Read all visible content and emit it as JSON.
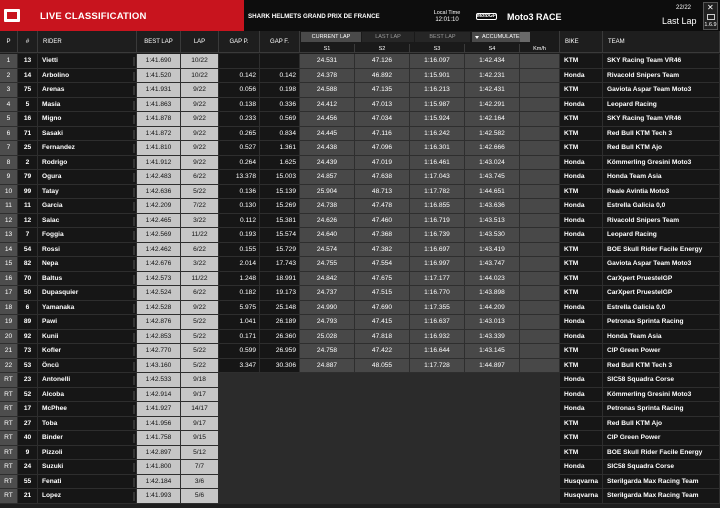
{
  "header": {
    "title": "LIVE CLASSIFICATION",
    "event": "SHARK HELMETS GRAND PRIX DE FRANCE",
    "local_time_label": "Local Time",
    "local_time": "12:01:10",
    "series_logo": "MotoGP",
    "race": "Moto3 RACE",
    "lap_counter": "22/22",
    "lap_status": "Last Lap",
    "close_glyph": "✕",
    "version": "1.6.9"
  },
  "columns": {
    "pos": "P",
    "num": "#",
    "rider": "RIDER",
    "best_lap": "BEST LAP",
    "lap": "LAP",
    "gap_p": "GAP P.",
    "gap_f": "GAP F.",
    "current_lap": "CURRENT LAP",
    "last_lap": "LAST LAP",
    "best_lap_tab": "BEST LAP",
    "accumulated": "ACCUMULATED",
    "s1": "S1",
    "s2": "S2",
    "s3": "S3",
    "s4": "S4",
    "speed": "Km/h",
    "bike": "BIKE",
    "team": "TEAM"
  },
  "rows": [
    {
      "pos": "1",
      "num": "13",
      "rider": "Vietti",
      "best": "1:41.690",
      "lap": "10/22",
      "gp": "",
      "gf": "",
      "s1": "24.531",
      "s2": "47.126",
      "s3": "1:16.097",
      "s4": "1:42.434",
      "bike": "KTM",
      "team": "SKY Racing Team VR46"
    },
    {
      "pos": "2",
      "num": "14",
      "rider": "Arbolino",
      "best": "1:41.520",
      "lap": "10/22",
      "gp": "0.142",
      "gf": "0.142",
      "s1": "24.378",
      "s2": "46.892",
      "s3": "1:15.901",
      "s4": "1:42.231",
      "bike": "Honda",
      "team": "Rivacold Snipers Team"
    },
    {
      "pos": "3",
      "num": "75",
      "rider": "Arenas",
      "best": "1:41.931",
      "bestbg": "lap",
      "lap": "9/22",
      "gp": "0.056",
      "gf": "0.198",
      "s1": "24.588",
      "s2": "47.135",
      "s3": "1:16.213",
      "s4": "1:42.431",
      "bike": "KTM",
      "team": "Gaviota Aspar Team Moto3"
    },
    {
      "pos": "4",
      "num": "5",
      "rider": "Masia",
      "best": "1:41.863",
      "lap": "9/22",
      "gp": "0.138",
      "gf": "0.336",
      "s1": "24.412",
      "s2": "47.013",
      "s3": "1:15.987",
      "s4": "1:42.291",
      "bike": "Honda",
      "team": "Leopard Racing"
    },
    {
      "pos": "5",
      "num": "16",
      "rider": "Migno",
      "best": "1:41.878",
      "lap": "9/22",
      "gp": "0.233",
      "gf": "0.569",
      "s1": "24.456",
      "s2": "47.034",
      "s3": "1:15.924",
      "s4": "1:42.164",
      "bike": "KTM",
      "team": "SKY Racing Team VR46"
    },
    {
      "pos": "6",
      "num": "71",
      "rider": "Sasaki",
      "best": "1:41.872",
      "lap": "9/22",
      "gp": "0.265",
      "gf": "0.834",
      "s1": "24.445",
      "s2": "47.116",
      "s3": "1:16.242",
      "s4": "1:42.582",
      "bike": "KTM",
      "team": "Red Bull KTM Tech 3"
    },
    {
      "pos": "7",
      "num": "25",
      "rider": "Fernandez",
      "best": "1:41.810",
      "lap": "9/22",
      "gp": "0.527",
      "gf": "1.361",
      "s1": "24.438",
      "s2": "47.096",
      "s3": "1:16.301",
      "s4": "1:42.666",
      "bike": "KTM",
      "team": "Red Bull KTM Ajo"
    },
    {
      "pos": "8",
      "num": "2",
      "rider": "Rodrigo",
      "best": "1:41.912",
      "lap": "9/22",
      "gp": "0.264",
      "gf": "1.625",
      "s1": "24.439",
      "s2": "47.019",
      "s3": "1:16.461",
      "s4": "1:43.024",
      "bike": "Honda",
      "team": "Kömmerling Gresini Moto3"
    },
    {
      "pos": "9",
      "num": "79",
      "rider": "Ogura",
      "best": "1:42.483",
      "lap": "6/22",
      "gp": "13.378",
      "gf": "15.003",
      "s1": "24.857",
      "s2": "47.638",
      "s3": "1:17.043",
      "s4": "1:43.745",
      "bike": "Honda",
      "team": "Honda Team Asia"
    },
    {
      "pos": "10",
      "num": "99",
      "rider": "Tatay",
      "best": "1:42.636",
      "lap": "5/22",
      "gp": "0.136",
      "gf": "15.139",
      "s1": "25.904",
      "s2": "48.713",
      "s3": "1:17.782",
      "s4": "1:44.651",
      "bike": "KTM",
      "team": "Reale Avintia Moto3"
    },
    {
      "pos": "11",
      "num": "11",
      "rider": "Garcia",
      "best": "1:42.209",
      "lap": "7/22",
      "gp": "0.130",
      "gf": "15.269",
      "s1": "24.738",
      "s2": "47.478",
      "s3": "1:16.855",
      "s4": "1:43.636",
      "bike": "Honda",
      "team": "Estrella Galicia 0,0"
    },
    {
      "pos": "12",
      "num": "12",
      "rider": "Salac",
      "best": "1:42.465",
      "lap": "3/22",
      "gp": "0.112",
      "gf": "15.381",
      "s1": "24.626",
      "s2": "47.460",
      "s3": "1:16.719",
      "s4": "1:43.513",
      "bike": "Honda",
      "team": "Rivacold Snipers Team"
    },
    {
      "pos": "13",
      "num": "7",
      "rider": "Foggia",
      "best": "1:42.569",
      "lap": "11/22",
      "gp": "0.193",
      "gf": "15.574",
      "s1": "24.640",
      "s2": "47.368",
      "s3": "1:16.739",
      "s4": "1:43.530",
      "bike": "Honda",
      "team": "Leopard Racing"
    },
    {
      "pos": "14",
      "num": "54",
      "rider": "Rossi",
      "best": "1:42.462",
      "lap": "6/22",
      "gp": "0.155",
      "gf": "15.729",
      "s1": "24.574",
      "s2": "47.382",
      "s3": "1:16.697",
      "s4": "1:43.419",
      "bike": "KTM",
      "team": "BOE Skull Rider Facile Energy"
    },
    {
      "pos": "15",
      "num": "82",
      "rider": "Nepa",
      "best": "1:42.676",
      "lap": "3/22",
      "gp": "2.014",
      "gf": "17.743",
      "s1": "24.755",
      "s2": "47.554",
      "s3": "1:16.997",
      "s4": "1:43.747",
      "bike": "KTM",
      "team": "Gaviota Aspar Team Moto3"
    },
    {
      "pos": "16",
      "num": "70",
      "rider": "Baltus",
      "best": "1:42.573",
      "lap": "11/22",
      "gp": "1.248",
      "gf": "18.991",
      "s1": "24.842",
      "s2": "47.675",
      "s3": "1:17.177",
      "s4": "1:44.023",
      "bike": "KTM",
      "team": "CarXpert PruestelGP"
    },
    {
      "pos": "17",
      "num": "50",
      "rider": "Dupasquier",
      "best": "1:42.524",
      "lap": "6/22",
      "gp": "0.182",
      "gf": "19.173",
      "s1": "24.737",
      "s2": "47.515",
      "s3": "1:16.770",
      "s4": "1:43.898",
      "bike": "KTM",
      "team": "CarXpert PruestelGP"
    },
    {
      "pos": "18",
      "num": "6",
      "rider": "Yamanaka",
      "best": "1:42.528",
      "lap": "9/22",
      "gp": "5.975",
      "gf": "25.148",
      "s1": "24.990",
      "s2": "47.690",
      "s3": "1:17.355",
      "s4": "1:44.209",
      "bike": "Honda",
      "team": "Estrella Galicia 0,0"
    },
    {
      "pos": "19",
      "num": "89",
      "rider": "Pawi",
      "best": "1:42.876",
      "lap": "5/22",
      "gp": "1.041",
      "gf": "26.189",
      "s1": "24.793",
      "s2": "47.415",
      "s3": "1:16.637",
      "s4": "1:43.013",
      "bike": "Honda",
      "team": "Petronas Sprinta Racing"
    },
    {
      "pos": "20",
      "num": "92",
      "rider": "Kunii",
      "best": "1:42.853",
      "lap": "5/22",
      "gp": "0.171",
      "gf": "26.360",
      "s1": "25.028",
      "s2": "47.818",
      "s3": "1:16.932",
      "s4": "1:43.339",
      "bike": "Honda",
      "team": "Honda Team Asia"
    },
    {
      "pos": "21",
      "num": "73",
      "rider": "Kofler",
      "best": "1:42.770",
      "lap": "5/22",
      "gp": "0.599",
      "gf": "26.959",
      "s1": "24.758",
      "s2": "47.422",
      "s3": "1:16.644",
      "s4": "1:43.145",
      "bike": "KTM",
      "team": "CIP Green Power"
    },
    {
      "pos": "22",
      "num": "53",
      "rider": "Öncü",
      "best": "1:43.160",
      "lap": "5/22",
      "gp": "3.347",
      "gf": "30.306",
      "s1": "24.887",
      "s2": "48.055",
      "s3": "1:17.728",
      "s4": "1:44.897",
      "bike": "KTM",
      "team": "Red Bull KTM Tech 3"
    },
    {
      "pos": "RT",
      "num": "23",
      "rider": "Antonelli",
      "best": "1:42.533",
      "lap": "9/18",
      "gp": "",
      "gf": "",
      "s1": "",
      "s2": "",
      "s3": "",
      "s4": "",
      "bike": "Honda",
      "team": "SIC58 Squadra Corse"
    },
    {
      "pos": "RT",
      "num": "52",
      "rider": "Alcoba",
      "best": "1:42.914",
      "lap": "9/17",
      "gp": "",
      "gf": "",
      "s1": "",
      "s2": "",
      "s3": "",
      "s4": "",
      "bike": "Honda",
      "team": "Kömmerling Gresini Moto3"
    },
    {
      "pos": "RT",
      "num": "17",
      "rider": "McPhee",
      "best": "1:41.927",
      "lap": "14/17",
      "gp": "",
      "gf": "",
      "s1": "",
      "s2": "",
      "s3": "",
      "s4": "",
      "bike": "Honda",
      "team": "Petronas Sprinta Racing"
    },
    {
      "pos": "RT",
      "num": "27",
      "rider": "Toba",
      "best": "1:41.956",
      "lap": "9/17",
      "gp": "",
      "gf": "",
      "s1": "",
      "s2": "",
      "s3": "",
      "s4": "",
      "bike": "KTM",
      "team": "Red Bull KTM Ajo"
    },
    {
      "pos": "RT",
      "num": "40",
      "rider": "Binder",
      "best": "1:41.758",
      "lap": "9/15",
      "gp": "",
      "gf": "",
      "s1": "",
      "s2": "",
      "s3": "",
      "s4": "",
      "bike": "KTM",
      "team": "CIP Green Power"
    },
    {
      "pos": "RT",
      "num": "9",
      "rider": "Pizzoli",
      "best": "1:42.897",
      "lap": "5/12",
      "gp": "",
      "gf": "",
      "s1": "",
      "s2": "",
      "s3": "",
      "s4": "",
      "bike": "KTM",
      "team": "BOE Skull Rider Facile Energy"
    },
    {
      "pos": "RT",
      "num": "24",
      "rider": "Suzuki",
      "best": "1:41.800",
      "lap": "7/7",
      "gp": "",
      "gf": "",
      "s1": "",
      "s2": "",
      "s3": "",
      "s4": "",
      "bike": "Honda",
      "team": "SIC58 Squadra Corse"
    },
    {
      "pos": "RT",
      "num": "55",
      "rider": "Fenati",
      "best": "1:42.184",
      "lap": "3/6",
      "gp": "",
      "gf": "",
      "s1": "",
      "s2": "",
      "s3": "",
      "s4": "",
      "bike": "Husqvarna",
      "team": "Sterilgarda Max Racing Team"
    },
    {
      "pos": "RT",
      "num": "21",
      "rider": "Lopez",
      "best": "1:41.993",
      "lap": "5/6",
      "gp": "",
      "gf": "",
      "s1": "",
      "s2": "",
      "s3": "",
      "s4": "",
      "bike": "Husqvarna",
      "team": "Sterilgarda Max Racing Team"
    }
  ]
}
